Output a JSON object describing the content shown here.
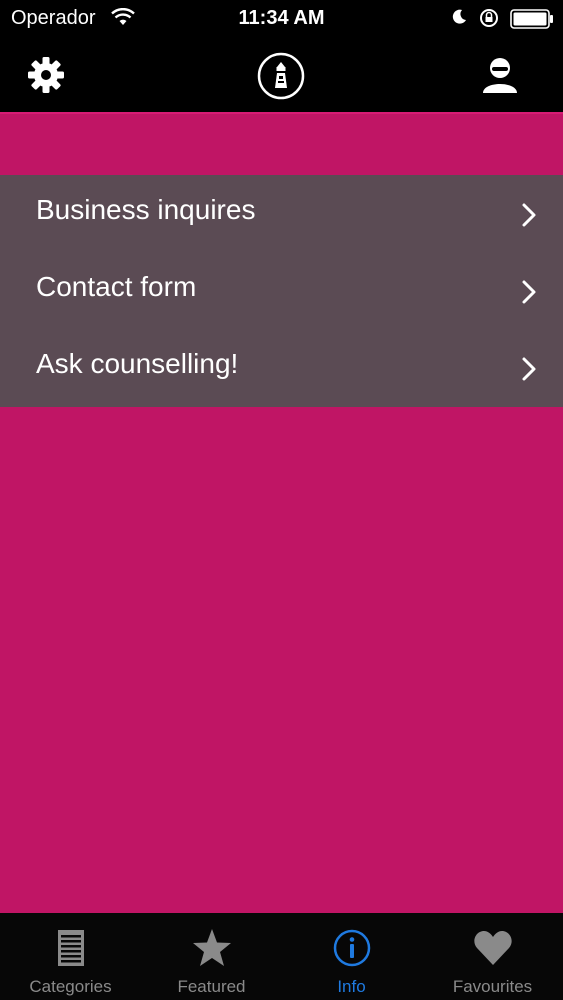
{
  "status_bar": {
    "carrier": "Operador",
    "time": "11:34 AM"
  },
  "nav": {
    "left_icon": "gear-icon",
    "center_icon": "lighthouse-info-logo",
    "right_icon": "user-icon"
  },
  "colors": {
    "background": "#c01565",
    "menu_background": "#5b4b54",
    "active_tab": "#1f7ae0",
    "inactive_tab": "#8a8a8a"
  },
  "menu": {
    "items": [
      {
        "label": "Business inquires"
      },
      {
        "label": "Contact form"
      },
      {
        "label": "Ask counselling!"
      }
    ]
  },
  "tab_bar": {
    "tabs": [
      {
        "label": "Categories",
        "icon": "document-icon"
      },
      {
        "label": "Featured",
        "icon": "star-icon"
      },
      {
        "label": "Info",
        "icon": "info-icon",
        "active": true
      },
      {
        "label": "Favourites",
        "icon": "heart-icon"
      }
    ]
  }
}
